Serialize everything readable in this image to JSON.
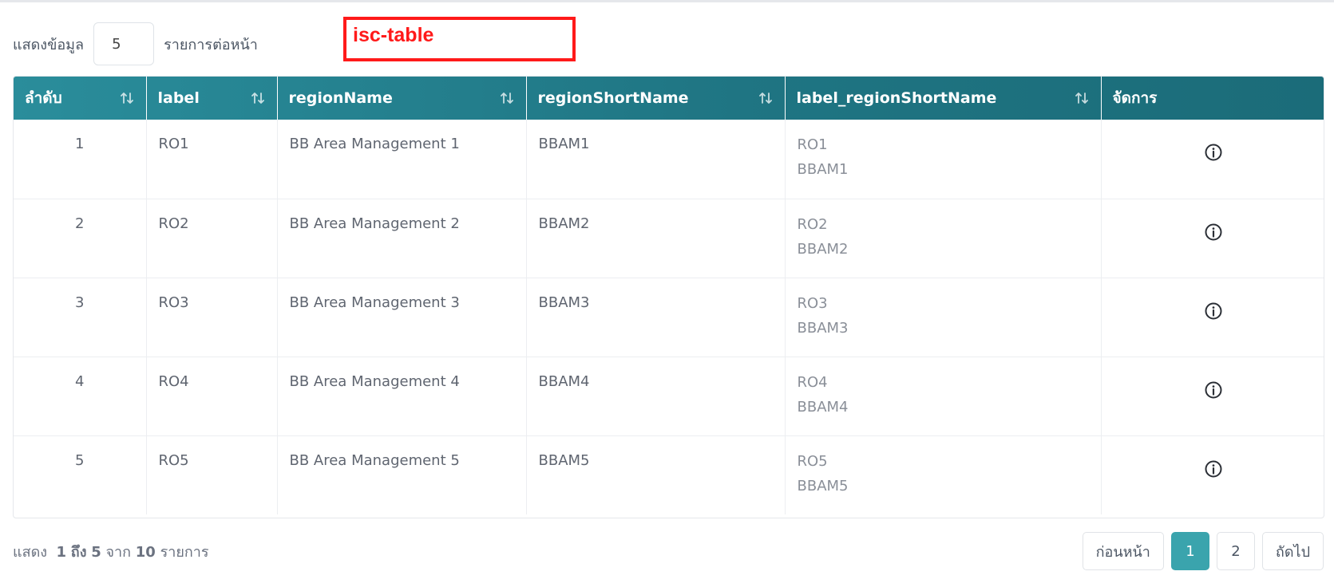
{
  "page_size": {
    "prefix_label": "แสดงข้อมูล",
    "value": "5",
    "suffix_label": "รายการต่อหน้า"
  },
  "annotation": {
    "label": "isc-table",
    "color": "#ff1a1a"
  },
  "table": {
    "header_colors": {
      "start": "#2a8d9b",
      "end": "#1b6c79"
    },
    "columns": [
      {
        "label": "ลำดับ",
        "sortable": true
      },
      {
        "label": "label",
        "sortable": true
      },
      {
        "label": "regionName",
        "sortable": true
      },
      {
        "label": "regionShortName",
        "sortable": true
      },
      {
        "label": "label_regionShortName",
        "sortable": true
      },
      {
        "label": "จัดการ",
        "sortable": false
      }
    ],
    "rows": [
      {
        "index": "1",
        "label": "RO1",
        "region_name": "BB Area Management 1",
        "region_short": "BBAM1",
        "combo_label": "RO1",
        "combo_short": "BBAM1",
        "action_icon": "info-icon"
      },
      {
        "index": "2",
        "label": "RO2",
        "region_name": "BB Area Management 2",
        "region_short": "BBAM2",
        "combo_label": "RO2",
        "combo_short": "BBAM2",
        "action_icon": "info-icon"
      },
      {
        "index": "3",
        "label": "RO3",
        "region_name": "BB Area Management 3",
        "region_short": "BBAM3",
        "combo_label": "RO3",
        "combo_short": "BBAM3",
        "action_icon": "info-icon"
      },
      {
        "index": "4",
        "label": "RO4",
        "region_name": "BB Area Management 4",
        "region_short": "BBAM4",
        "combo_label": "RO4",
        "combo_short": "BBAM4",
        "action_icon": "info-icon"
      },
      {
        "index": "5",
        "label": "RO5",
        "region_name": "BB Area Management 5",
        "region_short": "BBAM5",
        "combo_label": "RO5",
        "combo_short": "BBAM5",
        "action_icon": "info-icon"
      }
    ]
  },
  "footer": {
    "show_label": "แสดง",
    "range_from": "1",
    "to_label": "ถึง",
    "range_to": "5",
    "of_label": "จาก",
    "total": "10",
    "items_label": "รายการ"
  },
  "pagination": {
    "prev_label": "ก่อนหน้า",
    "pages": [
      "1",
      "2"
    ],
    "current_page": "1",
    "next_label": "ถัดไป",
    "active_color": "#3aa4ad"
  }
}
